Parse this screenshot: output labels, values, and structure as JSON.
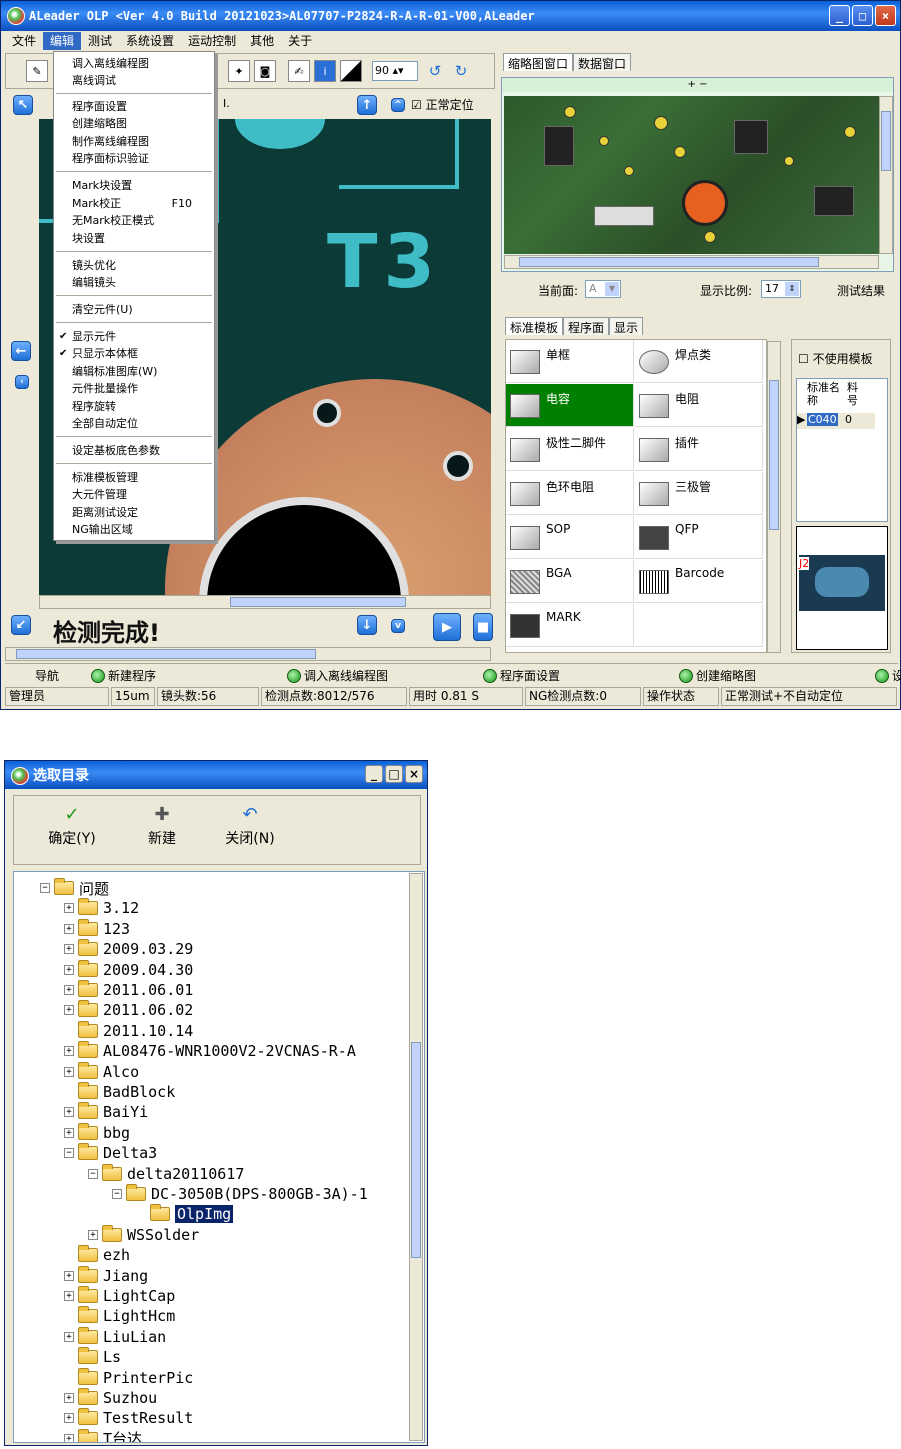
{
  "main_window": {
    "title": "ALeader OLP  <Ver 4.0 Build 20121023>AL07707-P2824-R-A-R-01-V00,ALeader",
    "window_buttons": [
      "_",
      "□",
      "×"
    ],
    "menu": [
      "文件",
      "编辑",
      "测试",
      "系统设置",
      "运动控制",
      "其他",
      "关于"
    ],
    "toolbar": {
      "zoom_value": "90"
    },
    "image_header": {
      "cursor_label": "I.",
      "normal_locate": "正常定位"
    },
    "pcb_label": "T3",
    "status_message": "检测完成!",
    "edit_menu": [
      [
        "调入离线编程图",
        "离线调试"
      ],
      [
        "程序面设置",
        "创建缩略图",
        "制作离线编程图",
        "程序面标识验证"
      ],
      [
        "Mark块设置",
        "Mark校正",
        "无Mark校正模式",
        "块设置"
      ],
      [
        "镜头优化",
        "编辑镜头"
      ],
      [
        "清空元件(U)"
      ],
      [
        "显示元件",
        "只显示本体框",
        "编辑标准图库(W)",
        "元件批量操作",
        "程序旋转",
        "全部自动定位"
      ],
      [
        "设定基板底色参数"
      ],
      [
        "标准模板管理",
        "大元件管理",
        "距离测试设定",
        "NG输出区域"
      ]
    ],
    "edit_menu_shortcut": "F10",
    "right_tabs_top": [
      "缩略图窗口",
      "数据窗口"
    ],
    "thumb_bar": "+ −",
    "current_side_label": "当前面:",
    "current_side_value": "A",
    "scale_label": "显示比例:",
    "scale_value": "17",
    "test_result": "测试结果",
    "template_tabs": [
      "标准模板",
      "程序面",
      "显示"
    ],
    "templates": [
      [
        "单框",
        "焊点类"
      ],
      [
        "电容",
        "电阻"
      ],
      [
        "极性二脚件",
        "插件"
      ],
      [
        "色环电阻",
        "三极管"
      ],
      [
        "SOP",
        "QFP"
      ],
      [
        "BGA",
        "Barcode"
      ],
      [
        "MARK",
        ""
      ]
    ],
    "no_template_label": "不使用模板",
    "parts_table": {
      "headers": [
        "标准名称",
        "料号"
      ],
      "row": [
        "C040",
        "0"
      ]
    },
    "preview_label": "J2",
    "nav_label": "导航",
    "nav_items": [
      "新建程序",
      "调入离线编程图",
      "程序面设置",
      "创建缩略图",
      "设"
    ],
    "status_cells": [
      "管理员",
      "15um",
      "镜头数:56",
      "检测点数:8012/576",
      "用时 0.81 S",
      "NG检测点数:0",
      "操作状态",
      "正常测试+不自动定位"
    ]
  },
  "dialog": {
    "title": "选取目录",
    "buttons": [
      {
        "icon": "✓",
        "label": "确定(Y)"
      },
      {
        "icon": "✚",
        "label": "新建"
      },
      {
        "icon": "↶",
        "label": "关闭(N)"
      }
    ],
    "tree": [
      {
        "label": "问题",
        "level": 0,
        "toggle": "-"
      },
      {
        "label": "3.12",
        "level": 1,
        "toggle": "+"
      },
      {
        "label": "123",
        "level": 1,
        "toggle": "+"
      },
      {
        "label": "2009.03.29",
        "level": 1,
        "toggle": "+"
      },
      {
        "label": "2009.04.30",
        "level": 1,
        "toggle": "+"
      },
      {
        "label": "2011.06.01",
        "level": 1,
        "toggle": "+"
      },
      {
        "label": "2011.06.02",
        "level": 1,
        "toggle": "+"
      },
      {
        "label": "2011.10.14",
        "level": 1,
        "toggle": ""
      },
      {
        "label": "AL08476-WNR1000V2-2VCNAS-R-A",
        "level": 1,
        "toggle": "+"
      },
      {
        "label": "Alco",
        "level": 1,
        "toggle": "+"
      },
      {
        "label": "BadBlock",
        "level": 1,
        "toggle": ""
      },
      {
        "label": "BaiYi",
        "level": 1,
        "toggle": "+"
      },
      {
        "label": "bbg",
        "level": 1,
        "toggle": "+"
      },
      {
        "label": "Delta3",
        "level": 1,
        "toggle": "-"
      },
      {
        "label": "delta20110617",
        "level": 2,
        "toggle": "-"
      },
      {
        "label": "DC-3050B(DPS-800GB-3A)-1",
        "level": 3,
        "toggle": "-"
      },
      {
        "label": "OlpImg",
        "level": 4,
        "toggle": "",
        "selected": true
      },
      {
        "label": "WSSolder",
        "level": 2,
        "toggle": "+"
      },
      {
        "label": "ezh",
        "level": 1,
        "toggle": ""
      },
      {
        "label": "Jiang",
        "level": 1,
        "toggle": "+"
      },
      {
        "label": "LightCap",
        "level": 1,
        "toggle": "+"
      },
      {
        "label": "LightHcm",
        "level": 1,
        "toggle": ""
      },
      {
        "label": "LiuLian",
        "level": 1,
        "toggle": "+"
      },
      {
        "label": "Ls",
        "level": 1,
        "toggle": ""
      },
      {
        "label": "PrinterPic",
        "level": 1,
        "toggle": ""
      },
      {
        "label": "Suzhou",
        "level": 1,
        "toggle": "+"
      },
      {
        "label": "TestResult",
        "level": 1,
        "toggle": "+"
      },
      {
        "label": "T台达",
        "level": 1,
        "toggle": "+"
      }
    ]
  }
}
